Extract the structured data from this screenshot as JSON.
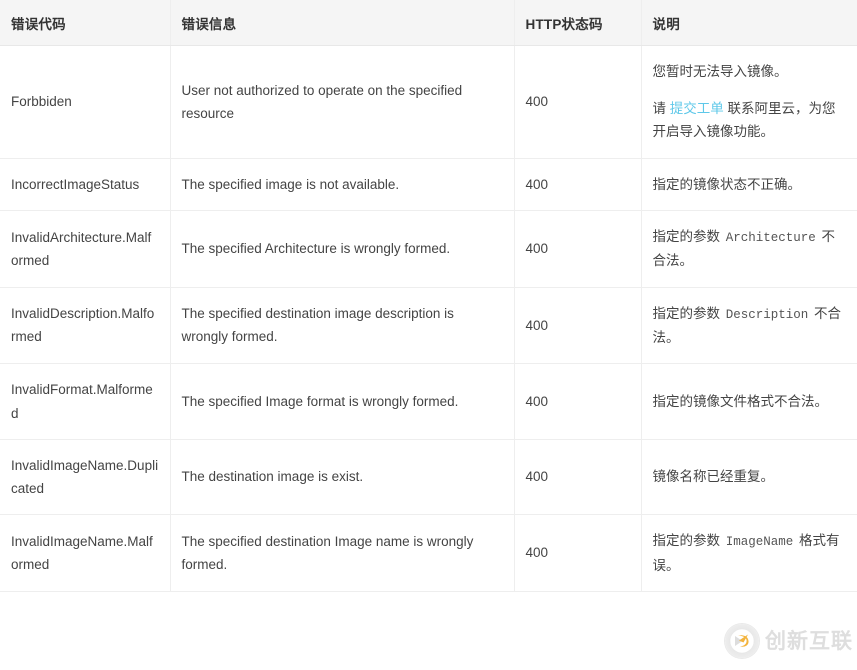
{
  "table": {
    "columns": [
      {
        "key": "code",
        "label": "错误代码"
      },
      {
        "key": "message",
        "label": "错误信息"
      },
      {
        "key": "status",
        "label": "HTTP状态码"
      },
      {
        "key": "desc",
        "label": "说明"
      }
    ],
    "rows": [
      {
        "code": "Forbbiden",
        "message": "User not authorized to operate on the specified resource",
        "status": "400",
        "desc_line1": "您暂时无法导入镜像。",
        "desc_line2_pre": "请 ",
        "desc_link": "提交工单",
        "desc_line2_post": " 联系阿里云，为您开启导入镜像功能。"
      },
      {
        "code": "IncorrectImageStatus",
        "message": "The specified image is not available.",
        "status": "400",
        "desc": "指定的镜像状态不正确。"
      },
      {
        "code": "InvalidArchitecture.Malformed",
        "message": "The specified Architecture is wrongly formed.",
        "status": "400",
        "desc_pre": "指定的参数 ",
        "desc_code": "Architecture",
        "desc_post": " 不合法。"
      },
      {
        "code": "InvalidDescription.Malformed",
        "message": "The specified destination image description is wrongly formed.",
        "status": "400",
        "desc_pre": "指定的参数 ",
        "desc_code": "Description",
        "desc_post": " 不合法。"
      },
      {
        "code": "InvalidFormat.Malformed",
        "message": "The specified Image format is wrongly formed.",
        "status": "400",
        "desc": "指定的镜像文件格式不合法。"
      },
      {
        "code": "InvalidImageName.Duplicated",
        "message": "The destination image is exist.",
        "status": "400",
        "desc": "镜像名称已经重复。"
      },
      {
        "code": "InvalidImageName.Malformed",
        "message": "The specified destination Image name is wrongly formed.",
        "status": "400",
        "desc_pre": "指定的参数 ",
        "desc_code": "ImageName",
        "desc_post": " 格式有误。"
      }
    ]
  },
  "watermark": {
    "text": "创新互联"
  },
  "colors": {
    "link": "#5ec8e9",
    "header_bg": "#f5f5f5",
    "border": "#eeeeee",
    "text": "#444444"
  }
}
